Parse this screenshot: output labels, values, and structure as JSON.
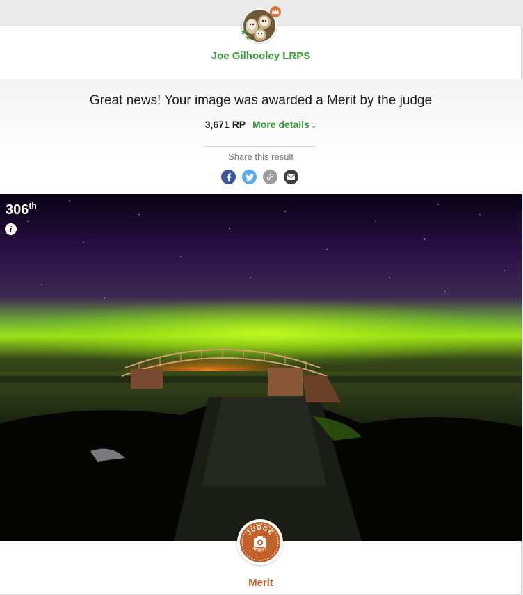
{
  "profile": {
    "name": "Joe Gilhooley LRPS",
    "avatar_icon": "owls-avatar",
    "crown_icon": "crown-icon",
    "stars_icon": "stars-icon"
  },
  "result": {
    "headline": "Great news! Your image was awarded a Merit by the judge",
    "points": "3,671 RP",
    "more_details": "More details"
  },
  "share": {
    "label": "Share this result",
    "buttons": [
      {
        "name": "facebook",
        "color": "#3b5998"
      },
      {
        "name": "twitter",
        "color": "#55acee"
      },
      {
        "name": "link",
        "color": "#9b9b9b"
      },
      {
        "name": "email",
        "color": "#3c3c3c"
      }
    ]
  },
  "photo": {
    "rank_number": "306",
    "rank_suffix": "th"
  },
  "badge": {
    "top_text": "JUDGE",
    "bottom_text": "MERIT",
    "award_label": "Merit",
    "color": "#c2612a"
  },
  "colors": {
    "accent_green": "#3a9a3a",
    "award_orange": "#c2612a"
  }
}
